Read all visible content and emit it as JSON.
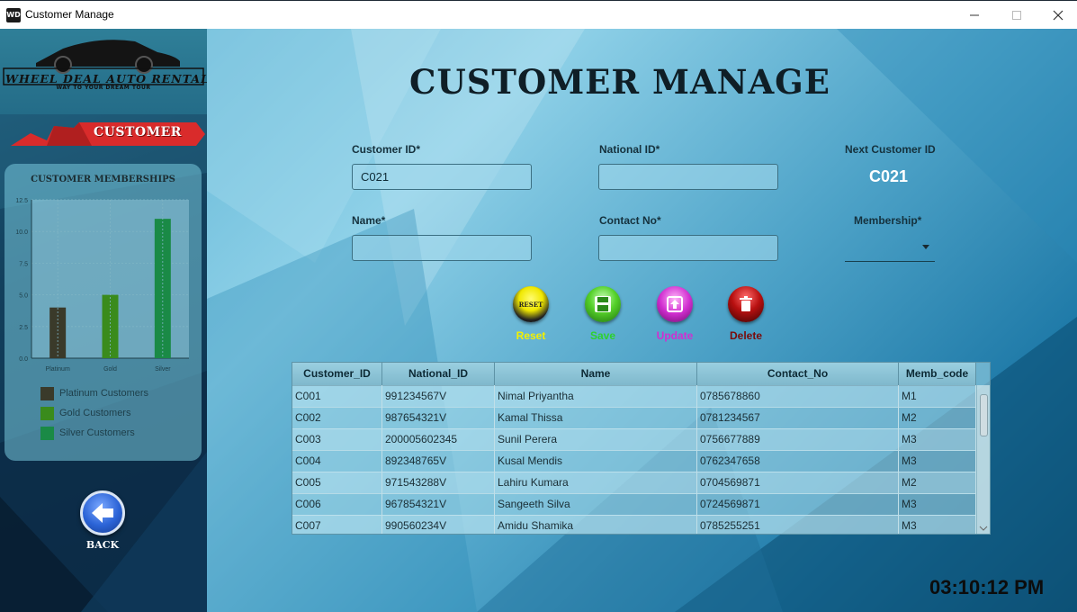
{
  "window": {
    "title": "Customer Manage",
    "icon_text": "WD"
  },
  "sidebar": {
    "logo_text": "WHEEL DEAL AUTO RENTAL",
    "logo_tagline": "WAY TO YOUR DREAM TOUR",
    "section_label": "CUSTOMER",
    "back_label": "BACK"
  },
  "chart_data": {
    "type": "bar",
    "title": "CUSTOMER MEMBERSHIPS",
    "categories": [
      "Platinum",
      "Gold",
      "Silver"
    ],
    "values": [
      4,
      5,
      11
    ],
    "colors": [
      "#3a3a2a",
      "#3a8b1c",
      "#1a8a46"
    ],
    "ylim": [
      0,
      12.5
    ],
    "yticks": [
      "0.0",
      "2.5",
      "5.0",
      "7.5",
      "10.0",
      "12.5"
    ],
    "grid": true,
    "legend": [
      "Platinum Customers",
      "Gold Customers",
      "Silver Customers"
    ],
    "legend_position": "bottom"
  },
  "form": {
    "title": "CUSTOMER MANAGE",
    "customer_id_label": "Customer ID*",
    "customer_id_value": "C021",
    "national_id_label": "National ID*",
    "national_id_value": "",
    "next_customer_id_label": "Next Customer ID",
    "next_customer_id_value": "C021",
    "name_label": "Name*",
    "name_value": "",
    "contact_label": "Contact No*",
    "contact_value": "",
    "membership_label": "Membership*",
    "membership_value": ""
  },
  "actions": {
    "reset_label": "Reset",
    "reset_icon_text": "RESET",
    "save_label": "Save",
    "save_icon_text": "SAVE",
    "update_label": "Update",
    "delete_label": "Delete",
    "colors": {
      "reset": "#f3f000",
      "save": "#2dd12d",
      "update": "#d12ed0",
      "delete": "#7a0a0a"
    }
  },
  "table": {
    "columns": [
      "Customer_ID",
      "National_ID",
      "Name",
      "Contact_No",
      "Memb_code"
    ],
    "rows": [
      [
        "C001",
        "991234567V",
        "Nimal Priyantha",
        "0785678860",
        "M1"
      ],
      [
        "C002",
        "987654321V",
        "Kamal Thissa",
        "0781234567",
        "M2"
      ],
      [
        "C003",
        "200005602345",
        "Sunil Perera",
        "0756677889",
        "M3"
      ],
      [
        "C004",
        "892348765V",
        "Kusal Mendis",
        "0762347658",
        "M3"
      ],
      [
        "C005",
        "971543288V",
        "Lahiru Kumara",
        "0704569871",
        "M2"
      ],
      [
        "C006",
        "967854321V",
        "Sangeeth Silva",
        "0724569871",
        "M3"
      ],
      [
        "C007",
        "990560234V",
        "Amidu Shamika",
        "0785255251",
        "M3"
      ]
    ]
  },
  "clock": "03:10:12 PM"
}
